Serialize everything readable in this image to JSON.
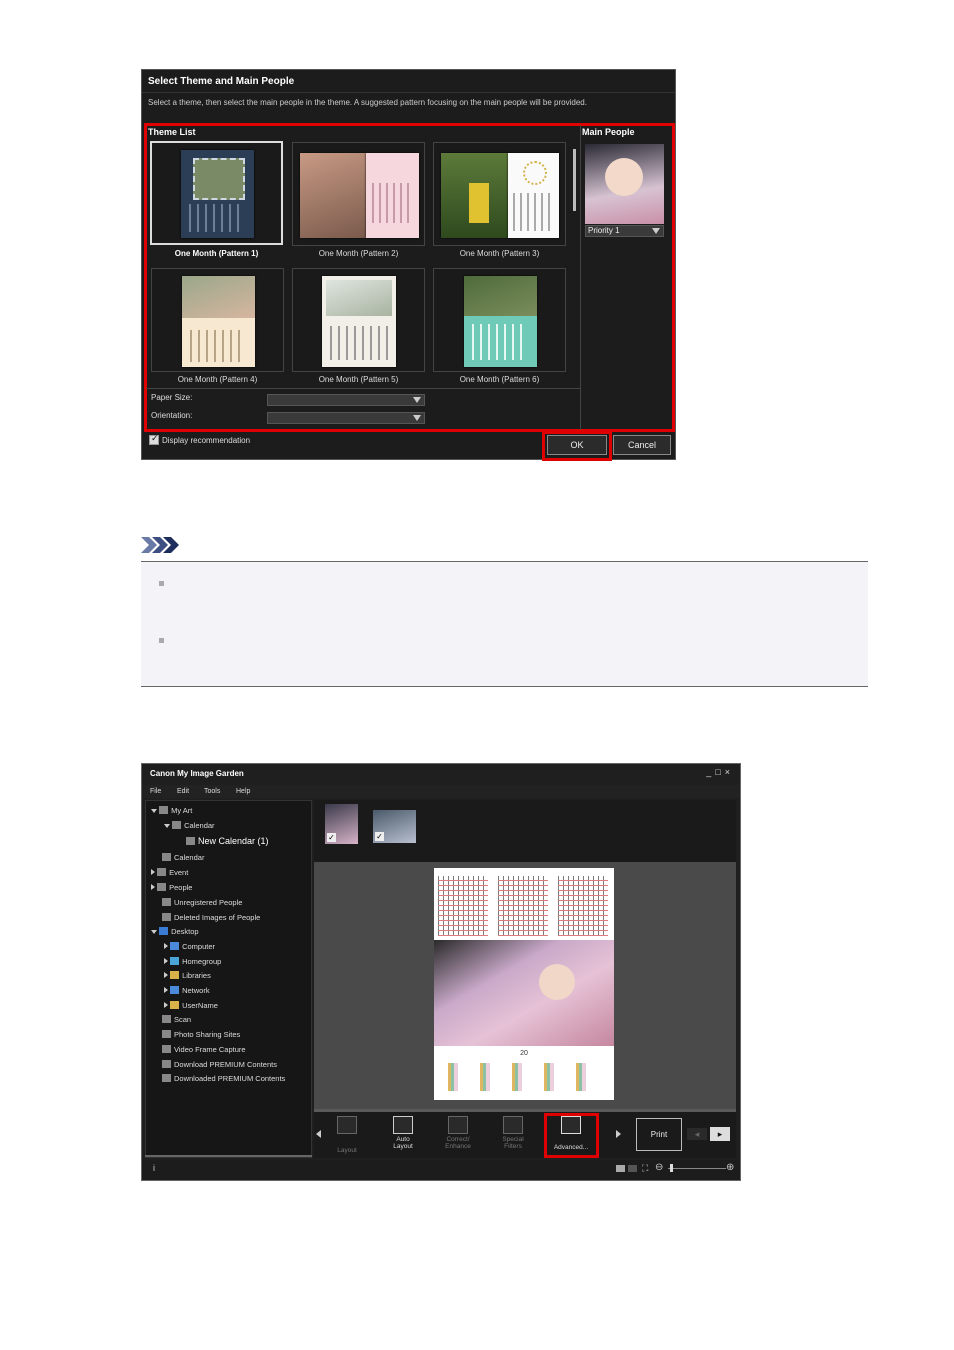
{
  "dialog": {
    "title": "Select Theme and Main People",
    "description": "Select a theme, then select the main people in the theme. A suggested pattern focusing on the main people will be provided.",
    "theme_list_label": "Theme List",
    "main_people_label": "Main People",
    "themes": [
      {
        "label": "One Month (Pattern 1)",
        "selected": true
      },
      {
        "label": "One Month (Pattern 2)",
        "selected": false
      },
      {
        "label": "One Month (Pattern 3)",
        "selected": false
      },
      {
        "label": "One Month (Pattern 4)",
        "selected": false
      },
      {
        "label": "One Month (Pattern 5)",
        "selected": false
      },
      {
        "label": "One Month (Pattern 6)",
        "selected": false
      }
    ],
    "priority": "Priority 1",
    "paper_size_label": "Paper Size:",
    "orientation_label": "Orientation:",
    "display_recommendation": "Display recommendation",
    "ok": "OK",
    "cancel": "Cancel"
  },
  "app": {
    "title": "Canon My Image Garden",
    "menu": [
      "File",
      "Edit",
      "Tools",
      "Help"
    ],
    "tree": {
      "my_art": "My Art",
      "calendar": "Calendar",
      "new_calendar": "New Calendar (1)",
      "calendar_root": "Calendar",
      "event": "Event",
      "people": "People",
      "unregistered": "Unregistered People",
      "deleted": "Deleted Images of People",
      "desktop": "Desktop",
      "computer": "Computer",
      "homegroup": "Homegroup",
      "libraries": "Libraries",
      "network": "Network",
      "username": "UserName",
      "scan": "Scan",
      "photo_sharing": "Photo Sharing Sites",
      "video_frame": "Video Frame Capture",
      "download_premium": "Download PREMIUM Contents",
      "downloaded_premium": "Downloaded PREMIUM Contents"
    },
    "calendar_year": "20",
    "toolbar": {
      "layout": "Layout",
      "auto_layout_1": "Auto",
      "auto_layout_2": "Layout",
      "correct_1": "Correct/",
      "correct_2": "Enhance",
      "special_1": "Special",
      "special_2": "Filters",
      "advanced": "Advanced...",
      "print": "Print"
    }
  },
  "colors": {
    "highlight": "#e00000",
    "dialog_bg": "#1c1c1c",
    "note_bg": "#f3f3f8"
  }
}
